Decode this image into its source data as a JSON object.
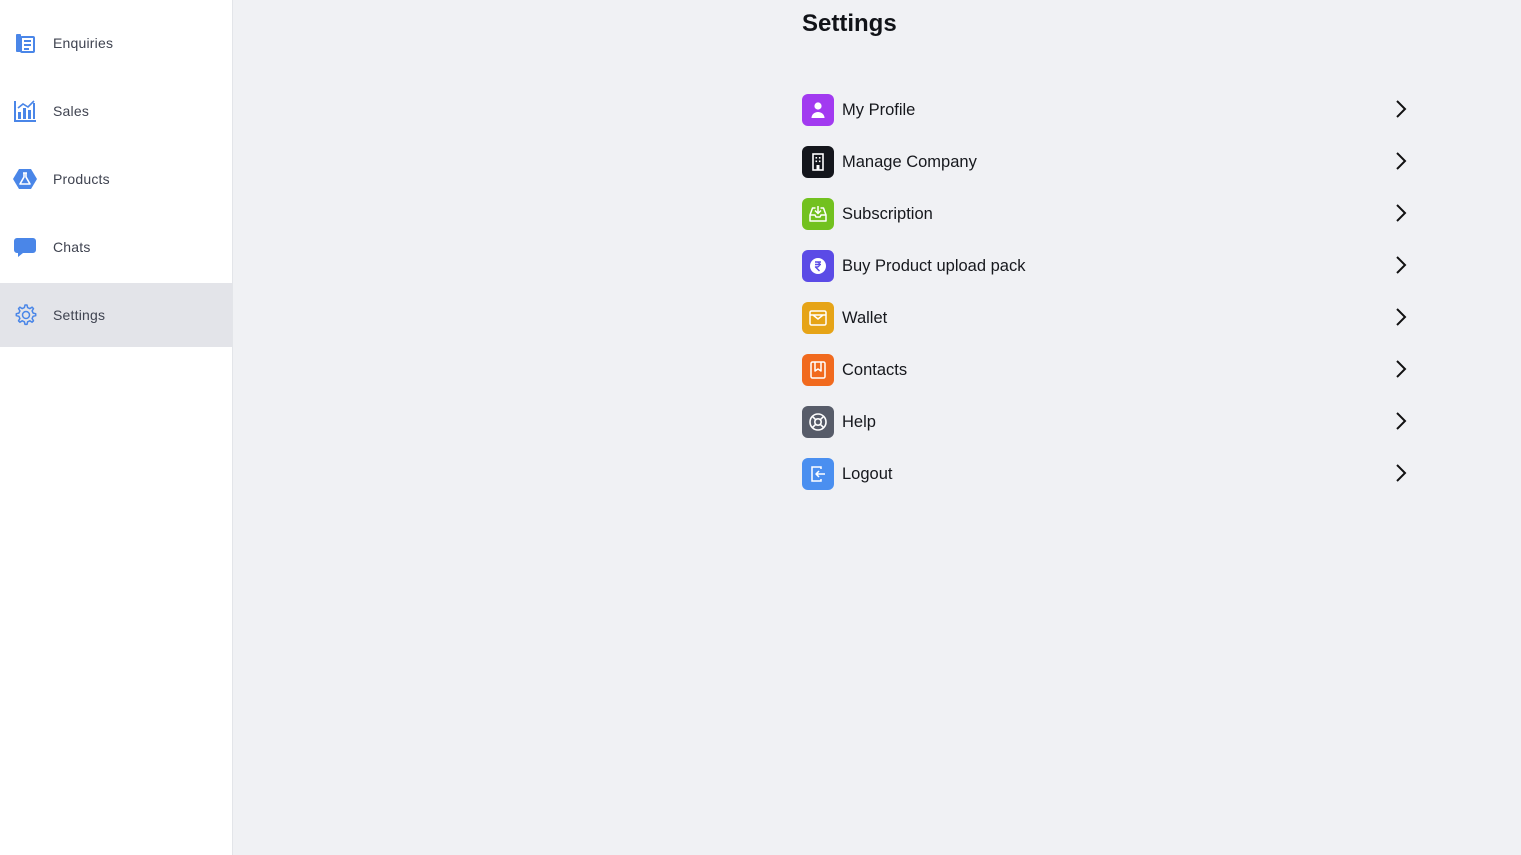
{
  "sidebar": {
    "items": [
      {
        "label": "Enquiries",
        "icon": "enquiries-icon"
      },
      {
        "label": "Sales",
        "icon": "sales-chart-icon"
      },
      {
        "label": "Products",
        "icon": "products-flask-icon"
      },
      {
        "label": "Chats",
        "icon": "chat-bubble-icon"
      },
      {
        "label": "Settings",
        "icon": "gear-icon",
        "active": true
      }
    ],
    "accent_color": "#4a86e8",
    "active_bg": "#e3e4e9"
  },
  "settings": {
    "title": "Settings",
    "items": [
      {
        "label": "My Profile",
        "icon": "user-icon",
        "color": "#a23af0"
      },
      {
        "label": "Manage Company",
        "icon": "building-icon",
        "color": "#14161c"
      },
      {
        "label": "Subscription",
        "icon": "inbox-download-icon",
        "color": "#72c11f"
      },
      {
        "label": "Buy Product upload pack",
        "icon": "rupee-icon",
        "color": "#5b4be6"
      },
      {
        "label": "Wallet",
        "icon": "wallet-icon",
        "color": "#e6a417"
      },
      {
        "label": "Contacts",
        "icon": "contacts-bookmark-icon",
        "color": "#f16a1e"
      },
      {
        "label": "Help",
        "icon": "lifebuoy-icon",
        "color": "#575c69"
      },
      {
        "label": "Logout",
        "icon": "logout-icon",
        "color": "#4a8ff0"
      }
    ]
  }
}
